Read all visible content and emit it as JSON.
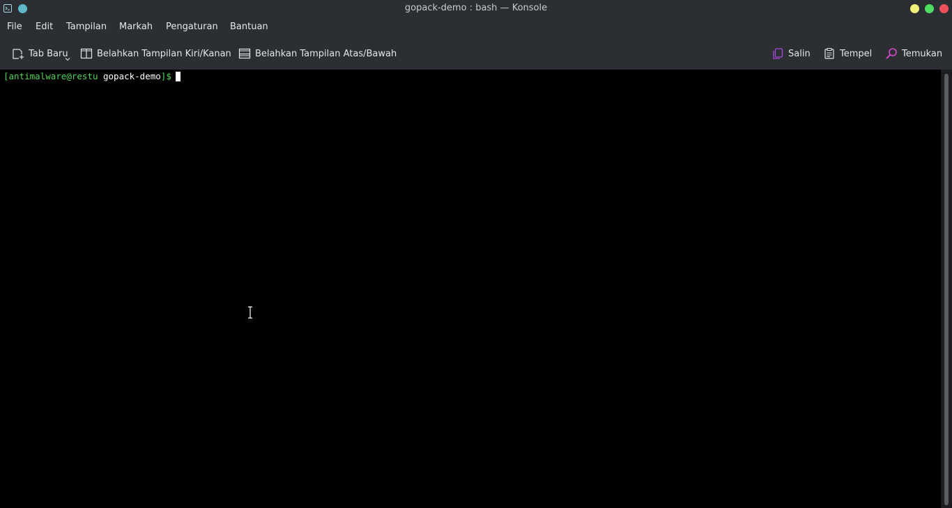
{
  "window": {
    "title": "gopack-demo : bash — Konsole"
  },
  "menubar": {
    "items": [
      "File",
      "Edit",
      "Tampilan",
      "Markah",
      "Pengaturan",
      "Bantuan"
    ]
  },
  "toolbar": {
    "new_tab": "Tab Baru",
    "split_left_right": "Belahkan Tampilan Kiri/Kanan",
    "split_top_bottom": "Belahkan Tampilan Atas/Bawah",
    "copy": "Salin",
    "paste": "Tempel",
    "find": "Temukan"
  },
  "terminal": {
    "prompt_open": "[",
    "user_host": "antimalware@restu",
    "cwd": "gopack-demo",
    "prompt_close": "]$"
  },
  "colors": {
    "chrome_bg": "#2b2e33",
    "terminal_bg": "#000000",
    "prompt_green": "#4fd65a",
    "accent_purple": "#a64bd9",
    "wm_minimize": "#f0f07a",
    "wm_maximize": "#4fdc63",
    "wm_close": "#f0505a"
  },
  "icons": {
    "app": "terminal-icon",
    "new_tab": "new-tab-icon",
    "split_lr": "split-left-right-icon",
    "split_tb": "split-top-bottom-icon",
    "copy": "copy-icon",
    "paste": "clipboard-icon",
    "find": "search-icon"
  }
}
